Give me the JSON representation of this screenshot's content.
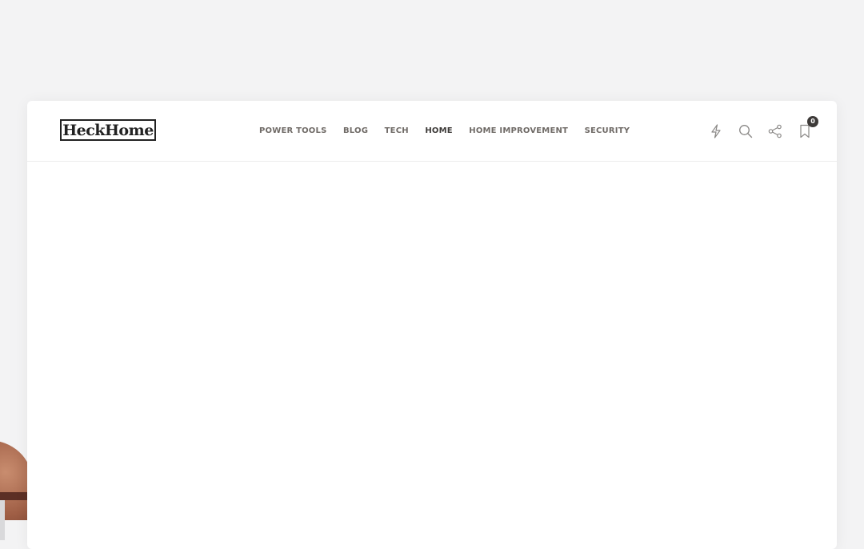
{
  "logo": {
    "text": "HeckHome"
  },
  "nav": {
    "items": [
      {
        "label": "POWER TOOLS"
      },
      {
        "label": "BLOG"
      },
      {
        "label": "TECH"
      },
      {
        "label": "HOME"
      },
      {
        "label": "HOME IMPROVEMENT"
      },
      {
        "label": "SECURITY"
      }
    ],
    "active": "HOME"
  },
  "icons": {
    "flash": "lightning-icon",
    "search": "search-icon",
    "share": "share-icon",
    "bookmark": "bookmark-icon",
    "bookmark_count": "0"
  },
  "colors": {
    "page_background": "#f3f3f4",
    "card_background": "#ffffff",
    "nav_text": "#6f6a66",
    "nav_active_text": "#3d3a38",
    "badge_background": "#3d3a38"
  }
}
